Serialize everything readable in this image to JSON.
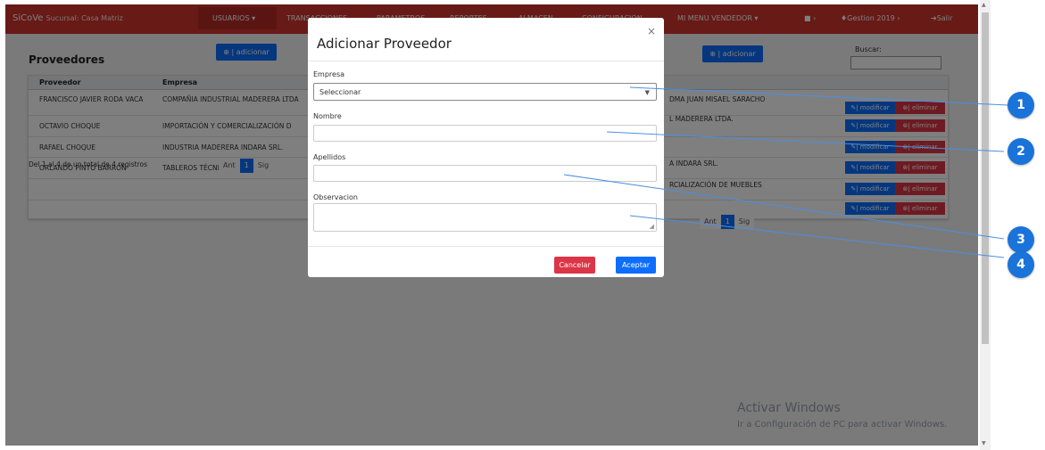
{
  "navbar": {
    "brand": "SiCoVe",
    "branch": "Sucursal: Casa Matriz",
    "items": [
      "USUARIOS ▾",
      "TRANSACCIONES",
      "PARAMETROS",
      "REPORTES",
      "ALMACEN",
      "CONFIGURACION",
      "MI MENU VENDEDOR ▾"
    ],
    "gestion": "Gestion 2019",
    "logout": "Salir"
  },
  "page": {
    "title": "Proveedores",
    "add_label": "| adicionar",
    "search_label": "Buscar:",
    "columns": [
      "Proveedor",
      "Empresa"
    ],
    "rows": [
      {
        "proveedor": "FRANCISCO JAVIER RODA VACA",
        "empresa": "COMPAÑIA INDUSTRIAL MADERERA LTDA",
        "empresa_right": "DMA JUAN MISAEL SARACHO"
      },
      {
        "proveedor": "OCTAVIO CHOQUE",
        "empresa": "IMPORTACIÓN Y COMERCIALIZACIÓN D",
        "empresa_right": "L MADERERA LTDA."
      },
      {
        "proveedor": "RAFAEL CHOQUE",
        "empresa": "INDUSTRIA MADERERA INDARA SRL.",
        "empresa_right": ""
      },
      {
        "proveedor": "ORLANDO PINTO BARRÓN",
        "empresa": "TABLEROS TÉCNICOS",
        "empresa_right": "A INDARA SRL."
      },
      {
        "proveedor": "",
        "empresa": "",
        "empresa_right": "RCIALIZACIÓN DE MUEBLES"
      },
      {
        "proveedor": "",
        "empresa": "",
        "empresa_right": ""
      }
    ],
    "modify_label": "| modificar",
    "delete_label": "| eliminar",
    "count_text": "Del 1 al 4 de un total de 4 registros",
    "pager": {
      "prev": "Ant",
      "current": "1",
      "next": "Sig"
    }
  },
  "modal": {
    "title": "Adicionar Proveedor",
    "close": "×",
    "empresa_label": "Empresa",
    "empresa_value": "Seleccionar",
    "nombre_label": "Nombre",
    "apellidos_label": "Apellidos",
    "observacion_label": "Observacion",
    "cancel_label": "Cancelar",
    "ok_label": "Aceptar"
  },
  "watermark": {
    "line1": "Activar Windows",
    "line2": "Ir a Configuración de PC para activar Windows."
  },
  "callouts": [
    "1",
    "2",
    "3",
    "4"
  ],
  "colors": {
    "navbar": "#d0342c",
    "primary": "#0d6efd",
    "danger": "#dc3545",
    "callout": "#1a73d9"
  }
}
